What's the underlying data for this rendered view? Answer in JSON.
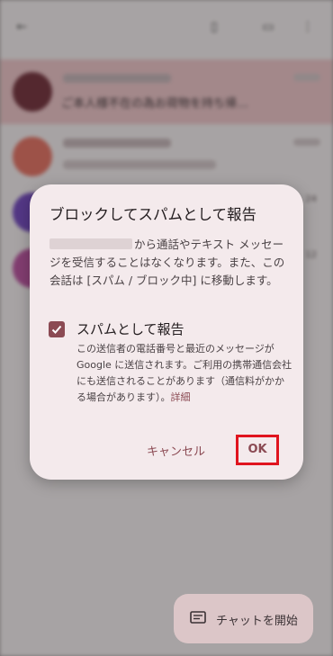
{
  "conversations": {
    "row1_preview": "ご本人様不在の為お荷物を持ち帰…",
    "row4_time": "12",
    "row3_time": "24"
  },
  "dialog": {
    "title": "ブロックしてスパムとして報告",
    "body_after_number": "から通話やテキスト メッセージを受信することはなくなります。また、この会話は [スパム / ブロック中] に移動します。",
    "checkbox_label": "スパムとして報告",
    "checkbox_checked": true,
    "checkbox_description": "この送信者の電話番号と最近のメッセージが Google に送信されます。ご利用の携帯通信会社にも送信されることがあります（通信料がかかる場合があります）。",
    "details_link": "詳細",
    "cancel_label": "キャンセル",
    "ok_label": "OK"
  },
  "fab": {
    "label": "チャットを開始",
    "icon": "chat-icon"
  },
  "colors": {
    "accent": "#8b4a53",
    "highlight_box": "#e0141e",
    "dialog_bg": "#f4eaec"
  }
}
